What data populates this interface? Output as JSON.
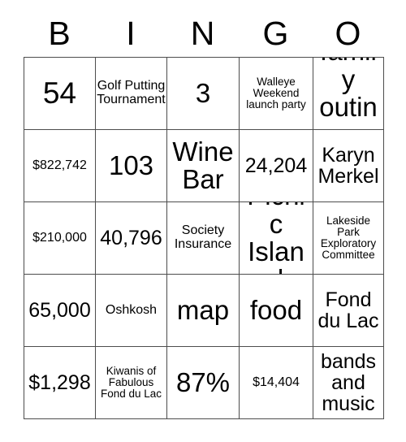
{
  "card": {
    "title": "BINGO",
    "headers": [
      "B",
      "I",
      "N",
      "G",
      "O"
    ],
    "rows": [
      [
        {
          "text": "54",
          "size": "fs-xl"
        },
        {
          "text": "Golf Putting Tournament",
          "size": "fs-sm"
        },
        {
          "text": "3",
          "size": "fs-lg"
        },
        {
          "text": "Walleye Weekend launch party",
          "size": "fs-xs"
        },
        {
          "text": "family outing",
          "size": "fs-lg"
        }
      ],
      [
        {
          "text": "$822,742",
          "size": "fs-sm"
        },
        {
          "text": "103",
          "size": "fs-lg"
        },
        {
          "text": "Wine Bar",
          "size": "fs-lg"
        },
        {
          "text": "24,204",
          "size": "fs-md"
        },
        {
          "text": "Karyn Merkel",
          "size": "fs-md"
        }
      ],
      [
        {
          "text": "$210,000",
          "size": "fs-sm"
        },
        {
          "text": "40,796",
          "size": "fs-md"
        },
        {
          "text": "Society Insurance",
          "size": "fs-sm"
        },
        {
          "text": "Picnic Island",
          "size": "fs-lg"
        },
        {
          "text": "Lakeside Park Exploratory Committee",
          "size": "fs-xs"
        }
      ],
      [
        {
          "text": "65,000",
          "size": "fs-md"
        },
        {
          "text": "Oshkosh",
          "size": "fs-sm"
        },
        {
          "text": "map",
          "size": "fs-lg"
        },
        {
          "text": "food",
          "size": "fs-lg"
        },
        {
          "text": "Fond du Lac",
          "size": "fs-md"
        }
      ],
      [
        {
          "text": "$1,298",
          "size": "fs-md"
        },
        {
          "text": "Kiwanis of Fabulous Fond du Lac",
          "size": "fs-xs"
        },
        {
          "text": "87%",
          "size": "fs-lg"
        },
        {
          "text": "$14,404",
          "size": "fs-sm"
        },
        {
          "text": "bands and music",
          "size": "fs-md"
        }
      ]
    ]
  },
  "colors": {
    "background": "#ffffff",
    "text": "#000000",
    "grid_line": "#4d4d4d"
  }
}
